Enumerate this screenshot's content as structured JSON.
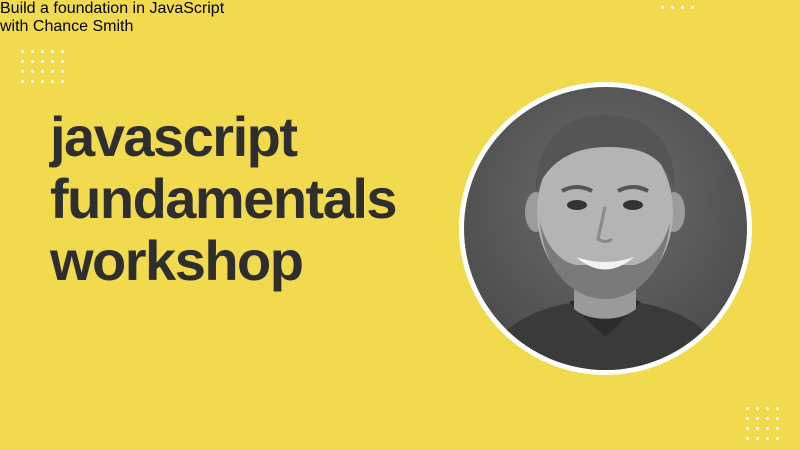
{
  "title_lines": [
    "javascript",
    "fundamentals",
    "workshop"
  ],
  "subtitle_lines": [
    "Build a foundation in JavaScript",
    "with Chance Smith"
  ],
  "colors": {
    "background": "#F1DA4E",
    "title": "#2E2E2E",
    "photo_ring": "#FFFFFF"
  },
  "icons": [
    "dot-grid-decoration",
    "presenter-photo"
  ]
}
